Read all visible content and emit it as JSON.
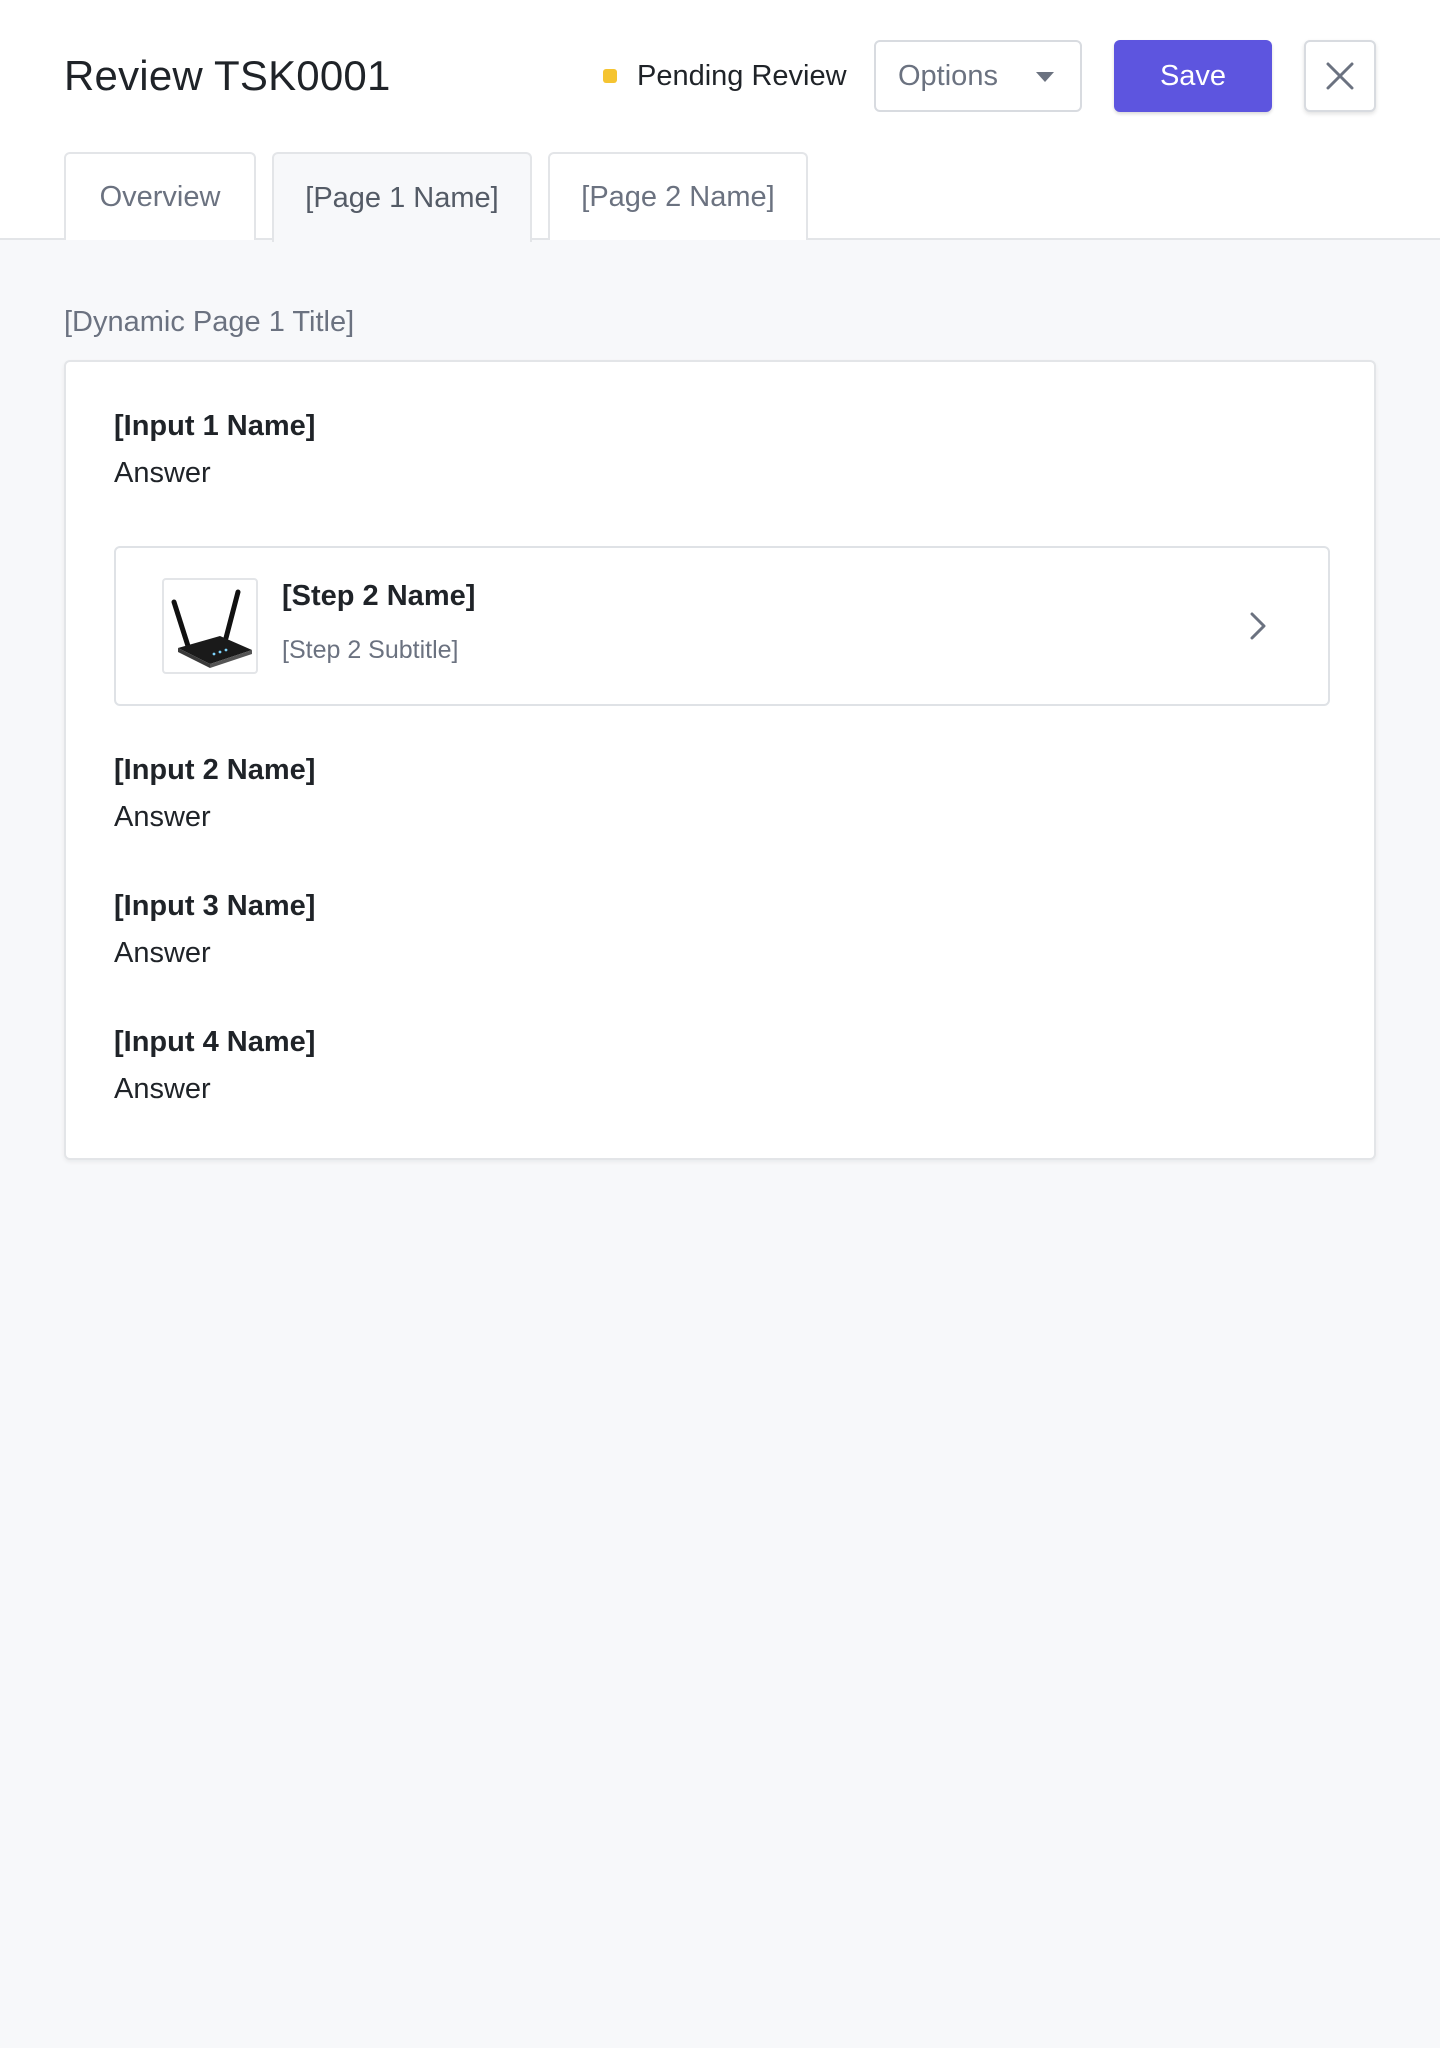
{
  "header": {
    "title": "Review TSK0001",
    "status": "Pending Review",
    "status_color": "#f5c431",
    "options_label": "Options",
    "save_label": "Save",
    "accent_color": "#5d55df"
  },
  "tabs": [
    {
      "label": "Overview",
      "active": false
    },
    {
      "label": "[Page 1 Name]",
      "active": true
    },
    {
      "label": "[Page 2 Name]",
      "active": false
    }
  ],
  "page": {
    "title": "[Dynamic Page 1 Title]",
    "inputs": [
      {
        "label": "[Input 1 Name]",
        "value": "Answer"
      },
      {
        "label": "[Input 2 Name]",
        "value": "Answer"
      },
      {
        "label": "[Input 3 Name]",
        "value": "Answer"
      },
      {
        "label": "[Input 4 Name]",
        "value": "Answer"
      }
    ],
    "step": {
      "name": "[Step 2 Name]",
      "subtitle": "[Step 2 Subtitle]",
      "thumbnail_icon": "router-icon"
    }
  }
}
